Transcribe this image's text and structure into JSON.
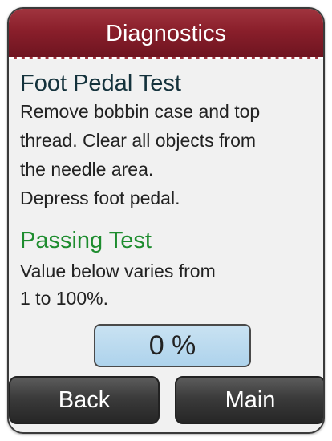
{
  "header": {
    "title": "Diagnostics"
  },
  "test": {
    "title": "Foot Pedal Test",
    "instructions": [
      "Remove bobbin case and top",
      "thread. Clear all objects from",
      "the needle area.",
      "Depress foot pedal."
    ]
  },
  "status": {
    "title": "Passing Test",
    "description": [
      "Value below varies from",
      "1 to 100%."
    ]
  },
  "readout": {
    "value": "0 %"
  },
  "buttons": {
    "back": "Back",
    "main": "Main"
  },
  "colors": {
    "header": "#8a1f2b",
    "status_pass": "#1d8c2e",
    "readout_bg": "#c9e2f2",
    "button_bg": "#3b3b3b"
  }
}
